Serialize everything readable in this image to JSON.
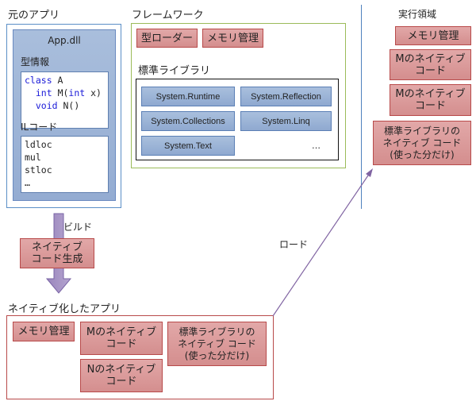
{
  "original_app": {
    "title": "元のアプリ",
    "assembly": "App.dll",
    "type_info_label": "型情報",
    "type_info_code": [
      [
        {
          "t": "class",
          "kw": true
        },
        {
          "t": " A",
          "kw": false
        }
      ],
      [
        {
          "t": "  ",
          "kw": false
        },
        {
          "t": "int",
          "kw": true
        },
        {
          "t": " M(",
          "kw": false
        },
        {
          "t": "int",
          "kw": true
        },
        {
          "t": " x)",
          "kw": false
        }
      ],
      [
        {
          "t": "  ",
          "kw": false
        },
        {
          "t": "void",
          "kw": true
        },
        {
          "t": " N()",
          "kw": false
        }
      ]
    ],
    "il_label": "ILコード",
    "il_code": [
      "ldloc",
      "mul",
      "stloc",
      "…"
    ]
  },
  "framework": {
    "title": "フレームワーク",
    "components": [
      "型ローダー",
      "メモリ管理"
    ],
    "stdlib_label": "標準ライブラリ",
    "stdlib_items": [
      "System.Runtime",
      "System.Reflection",
      "System.Collections",
      "System.Linq",
      "System.Text"
    ],
    "stdlib_more": "…"
  },
  "runtime_area": {
    "title": "実行領域",
    "items": [
      "メモリ管理",
      "Mのネイティブ\nコード",
      "Mのネイティブ\nコード",
      "標準ライブラリの\nネイティブ コード\n(使った分だけ)"
    ]
  },
  "build": {
    "arrow_label": "ビルド",
    "step": "ネイティブ\nコード生成"
  },
  "native_app": {
    "title": "ネイティブ化したアプリ",
    "items": [
      "メモリ管理",
      "Mのネイティブ\nコード",
      "標準ライブラリの\nネイティブ コード\n(使った分だけ)",
      "Nのネイティブ\nコード"
    ]
  },
  "load": {
    "arrow_label": "ロード"
  },
  "colors": {
    "red_fill": "#d99a9a",
    "red_border": "#b84a4a",
    "blue_fill": "#9cb4d8",
    "blue_border": "#5b7fb5",
    "framework_border": "#9bbb59",
    "arrow": "#8064a2"
  }
}
